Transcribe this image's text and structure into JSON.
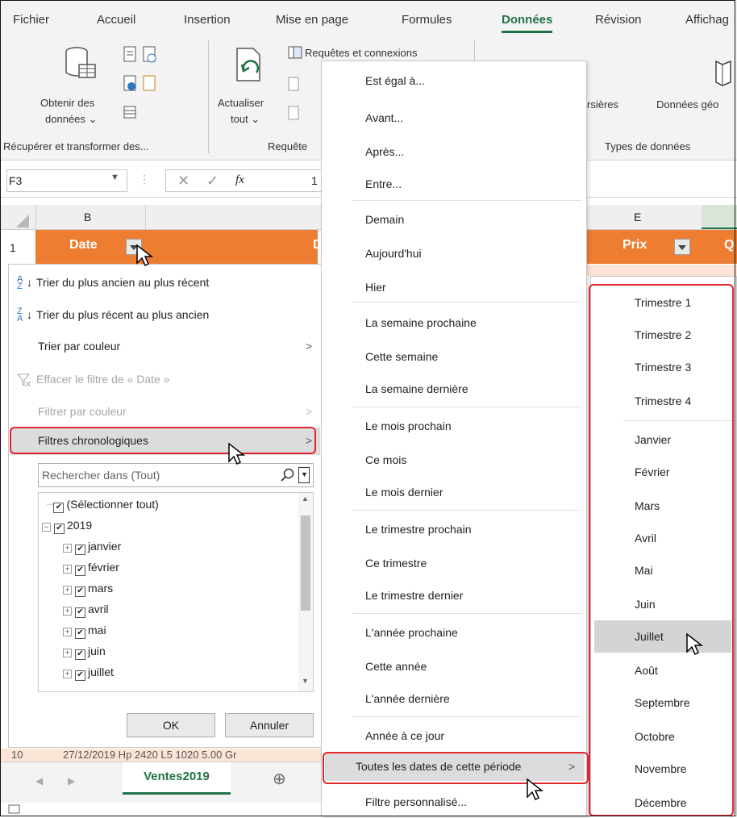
{
  "ribbon": {
    "tabs": [
      "Fichier",
      "Accueil",
      "Insertion",
      "Mise en page",
      "Formules",
      "Données",
      "Révision",
      "Affichag"
    ],
    "active_tab": "Données",
    "get_data_line1": "Obtenir des",
    "get_data_line2": "données ⌄",
    "refresh_line1": "Actualiser",
    "refresh_line2": "tout ⌄",
    "queries_label": "Requêtes et connexions",
    "stocks_label": "rsières",
    "geo_label": "Données géo",
    "group_get_transform": "Récupérer et transformer des...",
    "group_queries": "Requête",
    "group_data_types": "Types de données"
  },
  "formula_bar": {
    "name_box": "F3",
    "fx": "fx",
    "value": "1"
  },
  "sheet": {
    "col_b": "B",
    "col_e": "E",
    "row1": "1",
    "row_partial": "10",
    "header_date": "Date",
    "header_d": "D",
    "header_prix": "Prix",
    "header_q": "Q",
    "partial_row_text": "27/12/2019 Hp 2420 L5 1020 5.00 Gr",
    "sheet_tab": "Ventes2019",
    "add_sheet": "⊕"
  },
  "date_menu": {
    "sort_asc": "Trier du plus ancien au plus récent",
    "sort_desc": "Trier du plus récent au plus ancien",
    "sort_color": "Trier par couleur",
    "clear_filter": "Effacer le filtre de « Date »",
    "filter_color": "Filtrer par couleur",
    "date_filters": "Filtres chronologiques",
    "search_placeholder": "Rechercher dans (Tout)",
    "tree": [
      "(Sélectionner tout)",
      "2019",
      "janvier",
      "février",
      "mars",
      "avril",
      "mai",
      "juin",
      "juillet"
    ],
    "ok": "OK",
    "cancel": "Annuler"
  },
  "date_filters_menu": {
    "items": [
      "Est égal à...",
      "Avant...",
      "Après...",
      "Entre...",
      "Demain",
      "Aujourd'hui",
      "Hier",
      "La semaine prochaine",
      "Cette semaine",
      "La semaine dernière",
      "Le mois prochain",
      "Ce mois",
      "Le mois dernier",
      "Le trimestre prochain",
      "Ce trimestre",
      "Le trimestre dernier",
      "L'année prochaine",
      "Cette année",
      "L'année dernière",
      "Année à ce jour",
      "Toutes les dates de cette période",
      "Filtre personnalisé..."
    ]
  },
  "period_menu": {
    "items": [
      "Trimestre 1",
      "Trimestre 2",
      "Trimestre 3",
      "Trimestre 4",
      "Janvier",
      "Février",
      "Mars",
      "Avril",
      "Mai",
      "Juin",
      "Juillet",
      "Août",
      "Septembre",
      "Octobre",
      "Novembre",
      "Décembre"
    ],
    "highlighted": "Juillet"
  },
  "colors": {
    "accent_green": "#217346",
    "header_orange": "#ed7d31",
    "highlight_red": "#e0262e"
  }
}
